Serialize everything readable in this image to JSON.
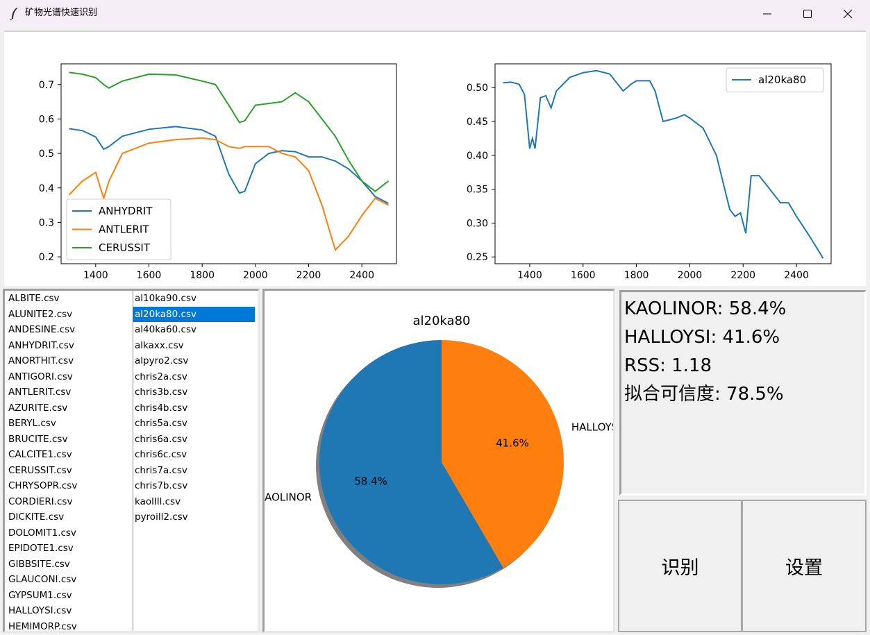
{
  "window": {
    "title": "矿物光谱快速识别"
  },
  "plots": {
    "left": {
      "xticks": [
        "1400",
        "1600",
        "1800",
        "2000",
        "2200",
        "2400"
      ],
      "yticks": [
        "0.2",
        "0.3",
        "0.4",
        "0.5",
        "0.6",
        "0.7"
      ],
      "legend": [
        "ANHYDRIT",
        "ANTLERIT",
        "CERUSSIT"
      ]
    },
    "right": {
      "xticks": [
        "1400",
        "1600",
        "1800",
        "2000",
        "2200",
        "2400"
      ],
      "yticks": [
        "0.25",
        "0.30",
        "0.35",
        "0.40",
        "0.45",
        "0.50"
      ],
      "legend": [
        "al20ka80"
      ]
    }
  },
  "chart_data": [
    {
      "type": "line",
      "xlim": [
        1270,
        2530
      ],
      "ylim": [
        0.18,
        0.76
      ],
      "grid": false,
      "legend_position": "lower-left",
      "x": [
        1300,
        1350,
        1400,
        1430,
        1450,
        1500,
        1600,
        1700,
        1800,
        1850,
        1900,
        1940,
        1960,
        2000,
        2050,
        2100,
        2150,
        2200,
        2250,
        2300,
        2350,
        2400,
        2450,
        2500
      ],
      "series": [
        {
          "name": "ANHYDRIT",
          "color": "#1f77b4",
          "values": [
            0.572,
            0.566,
            0.548,
            0.512,
            0.52,
            0.55,
            0.57,
            0.578,
            0.568,
            0.55,
            0.44,
            0.385,
            0.39,
            0.47,
            0.5,
            0.508,
            0.505,
            0.49,
            0.49,
            0.478,
            0.455,
            0.42,
            0.375,
            0.355
          ]
        },
        {
          "name": "ANTLERIT",
          "color": "#ff7f0e",
          "values": [
            0.38,
            0.42,
            0.445,
            0.37,
            0.42,
            0.5,
            0.53,
            0.54,
            0.545,
            0.54,
            0.52,
            0.515,
            0.52,
            0.52,
            0.52,
            0.5,
            0.49,
            0.45,
            0.35,
            0.22,
            0.26,
            0.32,
            0.37,
            0.35
          ]
        },
        {
          "name": "CERUSSIT",
          "color": "#2ca02c",
          "values": [
            0.735,
            0.73,
            0.72,
            0.7,
            0.69,
            0.71,
            0.73,
            0.728,
            0.71,
            0.7,
            0.64,
            0.59,
            0.595,
            0.64,
            0.645,
            0.65,
            0.676,
            0.65,
            0.6,
            0.55,
            0.48,
            0.42,
            0.39,
            0.42
          ]
        }
      ]
    },
    {
      "type": "line",
      "xlim": [
        1270,
        2530
      ],
      "ylim": [
        0.24,
        0.535
      ],
      "grid": false,
      "legend_position": "upper-right",
      "x": [
        1300,
        1330,
        1360,
        1380,
        1400,
        1410,
        1420,
        1440,
        1460,
        1480,
        1500,
        1550,
        1600,
        1650,
        1700,
        1750,
        1780,
        1800,
        1850,
        1870,
        1900,
        1950,
        1980,
        2000,
        2050,
        2100,
        2150,
        2170,
        2190,
        2210,
        2230,
        2260,
        2300,
        2340,
        2370,
        2400,
        2450,
        2500
      ],
      "series": [
        {
          "name": "al20ka80",
          "color": "#1f77b4",
          "values": [
            0.507,
            0.508,
            0.505,
            0.49,
            0.41,
            0.425,
            0.41,
            0.485,
            0.488,
            0.47,
            0.495,
            0.515,
            0.522,
            0.525,
            0.52,
            0.495,
            0.505,
            0.51,
            0.51,
            0.495,
            0.45,
            0.455,
            0.46,
            0.455,
            0.44,
            0.4,
            0.32,
            0.31,
            0.315,
            0.285,
            0.37,
            0.37,
            0.35,
            0.33,
            0.33,
            0.31,
            0.28,
            0.248
          ]
        }
      ]
    },
    {
      "type": "pie",
      "title": "al20ka80",
      "categories": [
        "KAOLINOR",
        "HALLOYSI"
      ],
      "values": [
        58.4,
        41.6
      ],
      "labels_pct": [
        "58.4%",
        "41.6%"
      ],
      "colors": [
        "#1f77b4",
        "#ff7f0e"
      ],
      "shadow": true
    }
  ],
  "lists": {
    "col1": [
      "ALBITE.csv",
      "ALUNITE2.csv",
      "ANDESINE.csv",
      "ANHYDRIT.csv",
      "ANORTHIT.csv",
      "ANTIGORI.csv",
      "ANTLERIT.csv",
      "AZURITE.csv",
      "BERYL.csv",
      "BRUCITE.csv",
      "CALCITE1.csv",
      "CERUSSIT.csv",
      "CHRYSOPR.csv",
      "CORDIERI.csv",
      "DICKITE.csv",
      "DOLOMIT1.csv",
      "EPIDOTE1.csv",
      "GIBBSITE.csv",
      "GLAUCONI.csv",
      "GYPSUM1.csv",
      "HALLOYSI.csv",
      "HEMIMORP.csv"
    ],
    "col2": [
      "al10ka90.csv",
      "al20ka80.csv",
      "al40ka60.csv",
      "alkaxx.csv",
      "alpyro2.csv",
      "chris2a.csv",
      "chris3b.csv",
      "chris4b.csv",
      "chris5a.csv",
      "chris6a.csv",
      "chris6c.csv",
      "chris7a.csv",
      "chris7b.csv",
      "kaolIll.csv",
      "pyroill2.csv"
    ],
    "selected": "al20ka80.csv"
  },
  "results": {
    "line1": "KAOLINOR: 58.4%",
    "line2": "HALLOYSI: 41.6%",
    "line3": "RSS: 1.18",
    "line4": "拟合可信度: 78.5%"
  },
  "buttons": {
    "identify": "识别",
    "settings": "设置"
  }
}
